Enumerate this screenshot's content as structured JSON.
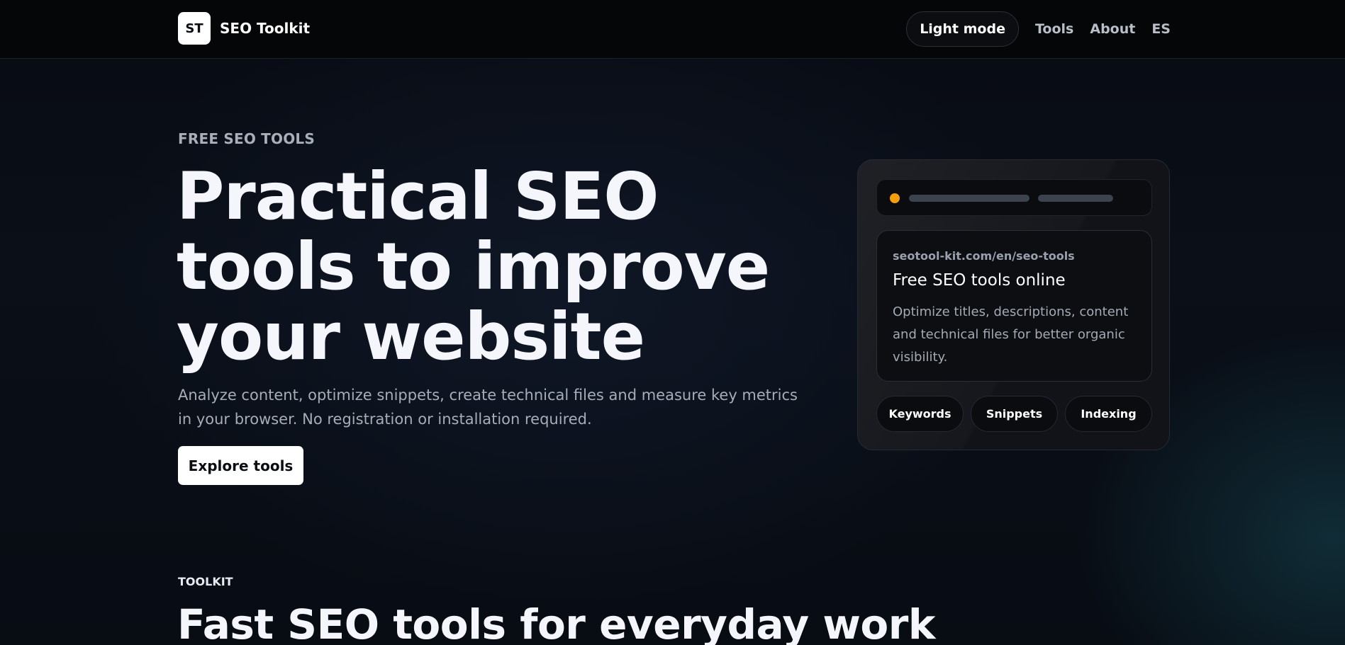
{
  "header": {
    "brand_badge": "ST",
    "brand_name": "SEO Toolkit",
    "theme_toggle": "Light mode",
    "nav": [
      "Tools",
      "About",
      "ES"
    ]
  },
  "hero": {
    "eyebrow": "FREE SEO TOOLS",
    "title": "Practical SEO tools to improve your website",
    "subtitle": "Analyze content, optimize snippets, create technical files and measure key metrics in your browser. No registration or installation required.",
    "cta": "Explore tools"
  },
  "preview_card": {
    "status_dot_color": "#f59e0b",
    "snippet": {
      "url": "seotool-kit.com/en/seo-tools",
      "title": "Free SEO tools online",
      "description": "Optimize titles, descriptions, content and technical files for better organic visibility."
    },
    "chips": [
      "Keywords",
      "Snippets",
      "Indexing"
    ]
  },
  "toolkit": {
    "eyebrow": "TOOLKIT",
    "title": "Fast SEO tools for everyday work"
  },
  "colors": {
    "background": "#080b12",
    "accent_dot": "#f59e0b",
    "primary_button": "#ffffff"
  }
}
